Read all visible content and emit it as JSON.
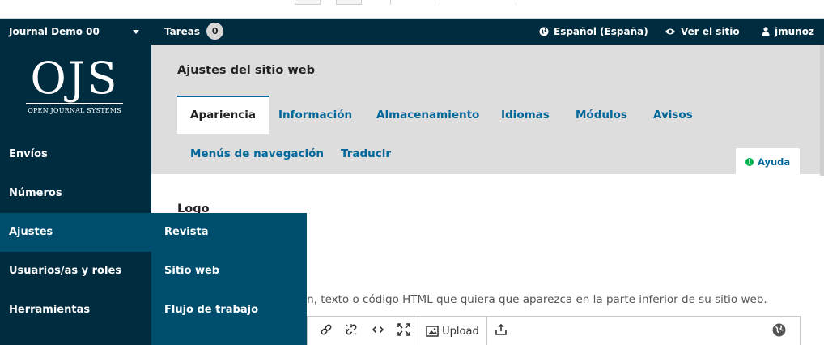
{
  "header": {
    "journal_name": "Journal Demo 00",
    "tasks_label": "Tareas",
    "tasks_count": "0",
    "language": "Español (España)",
    "view_site": "Ver el sitio",
    "username": "jmunoz"
  },
  "logo": {
    "big": "OJS",
    "small": "OPEN JOURNAL SYSTEMS"
  },
  "sidebar": {
    "items": [
      {
        "label": "Envíos"
      },
      {
        "label": "Números"
      },
      {
        "label": "Ajustes",
        "active": true
      },
      {
        "label": "Usuarios/as y roles"
      },
      {
        "label": "Herramientas"
      }
    ]
  },
  "submenu": {
    "items": [
      {
        "label": "Revista"
      },
      {
        "label": "Sitio web"
      },
      {
        "label": "Flujo de trabajo"
      }
    ]
  },
  "main": {
    "page_title": "Ajustes del sitio web",
    "tabs": [
      {
        "label": "Apariencia",
        "active": true
      },
      {
        "label": "Información"
      },
      {
        "label": "Almacenamiento"
      },
      {
        "label": "Idiomas"
      },
      {
        "label": "Módulos"
      },
      {
        "label": "Avisos"
      },
      {
        "label": "Menús de navegación"
      },
      {
        "label": "Traducir"
      }
    ],
    "help_label": "Ayuda",
    "section_title": "Logo",
    "description": "agen, texto o código HTML que quiera que aparezca en la parte inferior de su sitio web.",
    "editor": {
      "upload_label": "Upload"
    }
  },
  "colors": {
    "nav_bg": "#002c40",
    "nav_active": "#004e6e",
    "link": "#006798",
    "help_dot": "#00b24e"
  }
}
